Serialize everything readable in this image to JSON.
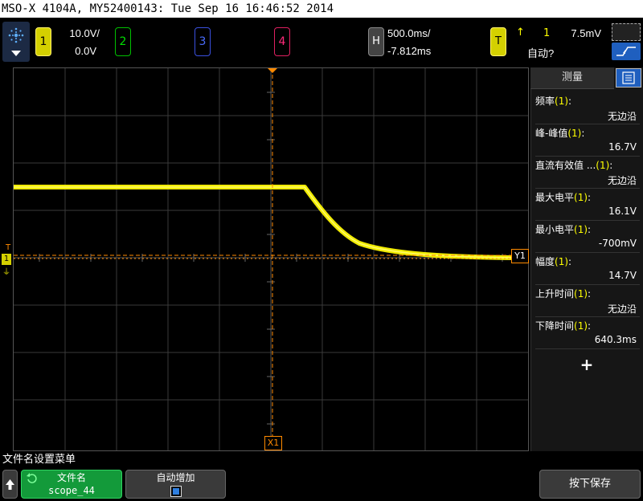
{
  "title_bar": {
    "text": "MSO-X 4104A, MY52400143: Tue Sep 16 16:46:52 2014"
  },
  "channels": {
    "ch1": {
      "label": "1",
      "scale": "10.0V/",
      "offset": "0.0V",
      "color": "#f4ef00"
    },
    "ch2": {
      "label": "2",
      "color": "#00e000"
    },
    "ch3": {
      "label": "3",
      "color": "#4a6cff"
    },
    "ch4": {
      "label": "4",
      "color": "#ff2a7a"
    }
  },
  "horizontal": {
    "label": "H",
    "timebase": "500.0ms/",
    "delay": "-7.812ms"
  },
  "trigger": {
    "label": "T",
    "edge_symbol": "↑",
    "source": "1",
    "level": "7.5mV",
    "mode": "自动?"
  },
  "measure_panel": {
    "tab_label": "测量",
    "items": [
      {
        "name": "频率",
        "source": "(1)",
        "suffix": ":",
        "value": "无边沿"
      },
      {
        "name": "峰-峰值",
        "source": "(1)",
        "suffix": ":",
        "value": "16.7V"
      },
      {
        "name": "直流有效值 ...",
        "source": "(1)",
        "suffix": ":",
        "value": "无边沿"
      },
      {
        "name": "最大电平",
        "source": "(1)",
        "suffix": ":",
        "value": "16.1V"
      },
      {
        "name": "最小电平",
        "source": "(1)",
        "suffix": ":",
        "value": "-700mV"
      },
      {
        "name": "幅度",
        "source": "(1)",
        "suffix": ":",
        "value": "14.7V"
      },
      {
        "name": "上升时间",
        "source": "(1)",
        "suffix": ":",
        "value": "无边沿"
      },
      {
        "name": "下降时间",
        "source": "(1)",
        "suffix": ":",
        "value": "640.3ms"
      }
    ],
    "add_label": "+"
  },
  "markers": {
    "cursor_x": "X1",
    "cursor_y": "Y1",
    "trigger_marker": "T",
    "ground_marker": "1"
  },
  "waveform": {
    "color": "#f0eb00",
    "cursor_color": "#ff8a00"
  },
  "softkey_menu": {
    "title": "文件名设置菜单",
    "back_icon": "up-arrow-icon",
    "file_name_label": "文件名",
    "file_name_value": "scope_44",
    "auto_increment_label": "自动增加",
    "auto_increment_checked": true,
    "save_label": "按下保存"
  }
}
